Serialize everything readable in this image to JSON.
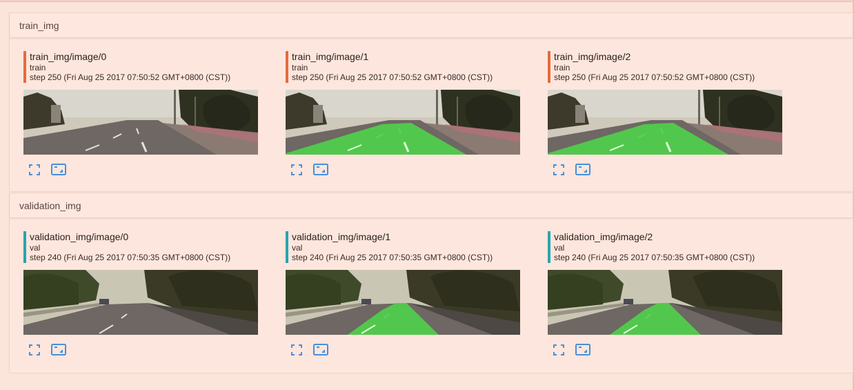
{
  "sections": [
    {
      "title": "train_img",
      "accent": "#e66a3c",
      "cards": [
        {
          "title": "train_img/image/0",
          "run": "train",
          "step": "step 250 (Fri Aug 25 2017 07:50:52 GMT+0800 (CST))",
          "overlay": false,
          "scene": "train"
        },
        {
          "title": "train_img/image/1",
          "run": "train",
          "step": "step 250 (Fri Aug 25 2017 07:50:52 GMT+0800 (CST))",
          "overlay": true,
          "scene": "train"
        },
        {
          "title": "train_img/image/2",
          "run": "train",
          "step": "step 250 (Fri Aug 25 2017 07:50:52 GMT+0800 (CST))",
          "overlay": true,
          "scene": "train"
        }
      ]
    },
    {
      "title": "validation_img",
      "accent": "#2aa3ad",
      "cards": [
        {
          "title": "validation_img/image/0",
          "run": "val",
          "step": "step 240 (Fri Aug 25 2017 07:50:35 GMT+0800 (CST))",
          "overlay": false,
          "scene": "val"
        },
        {
          "title": "validation_img/image/1",
          "run": "val",
          "step": "step 240 (Fri Aug 25 2017 07:50:35 GMT+0800 (CST))",
          "overlay": true,
          "scene": "val"
        },
        {
          "title": "validation_img/image/2",
          "run": "val",
          "step": "step 240 (Fri Aug 25 2017 07:50:35 GMT+0800 (CST))",
          "overlay": true,
          "scene": "val"
        }
      ]
    }
  ],
  "icons": {
    "expand": "expand-icon",
    "fit": "fit-to-window-icon",
    "color": "#4a8fd8"
  },
  "colors": {
    "road_overlay": "#4fd24a",
    "sky": "#d6cdbf",
    "asphalt": "#6e6763",
    "foliage": "#3b3a26"
  }
}
